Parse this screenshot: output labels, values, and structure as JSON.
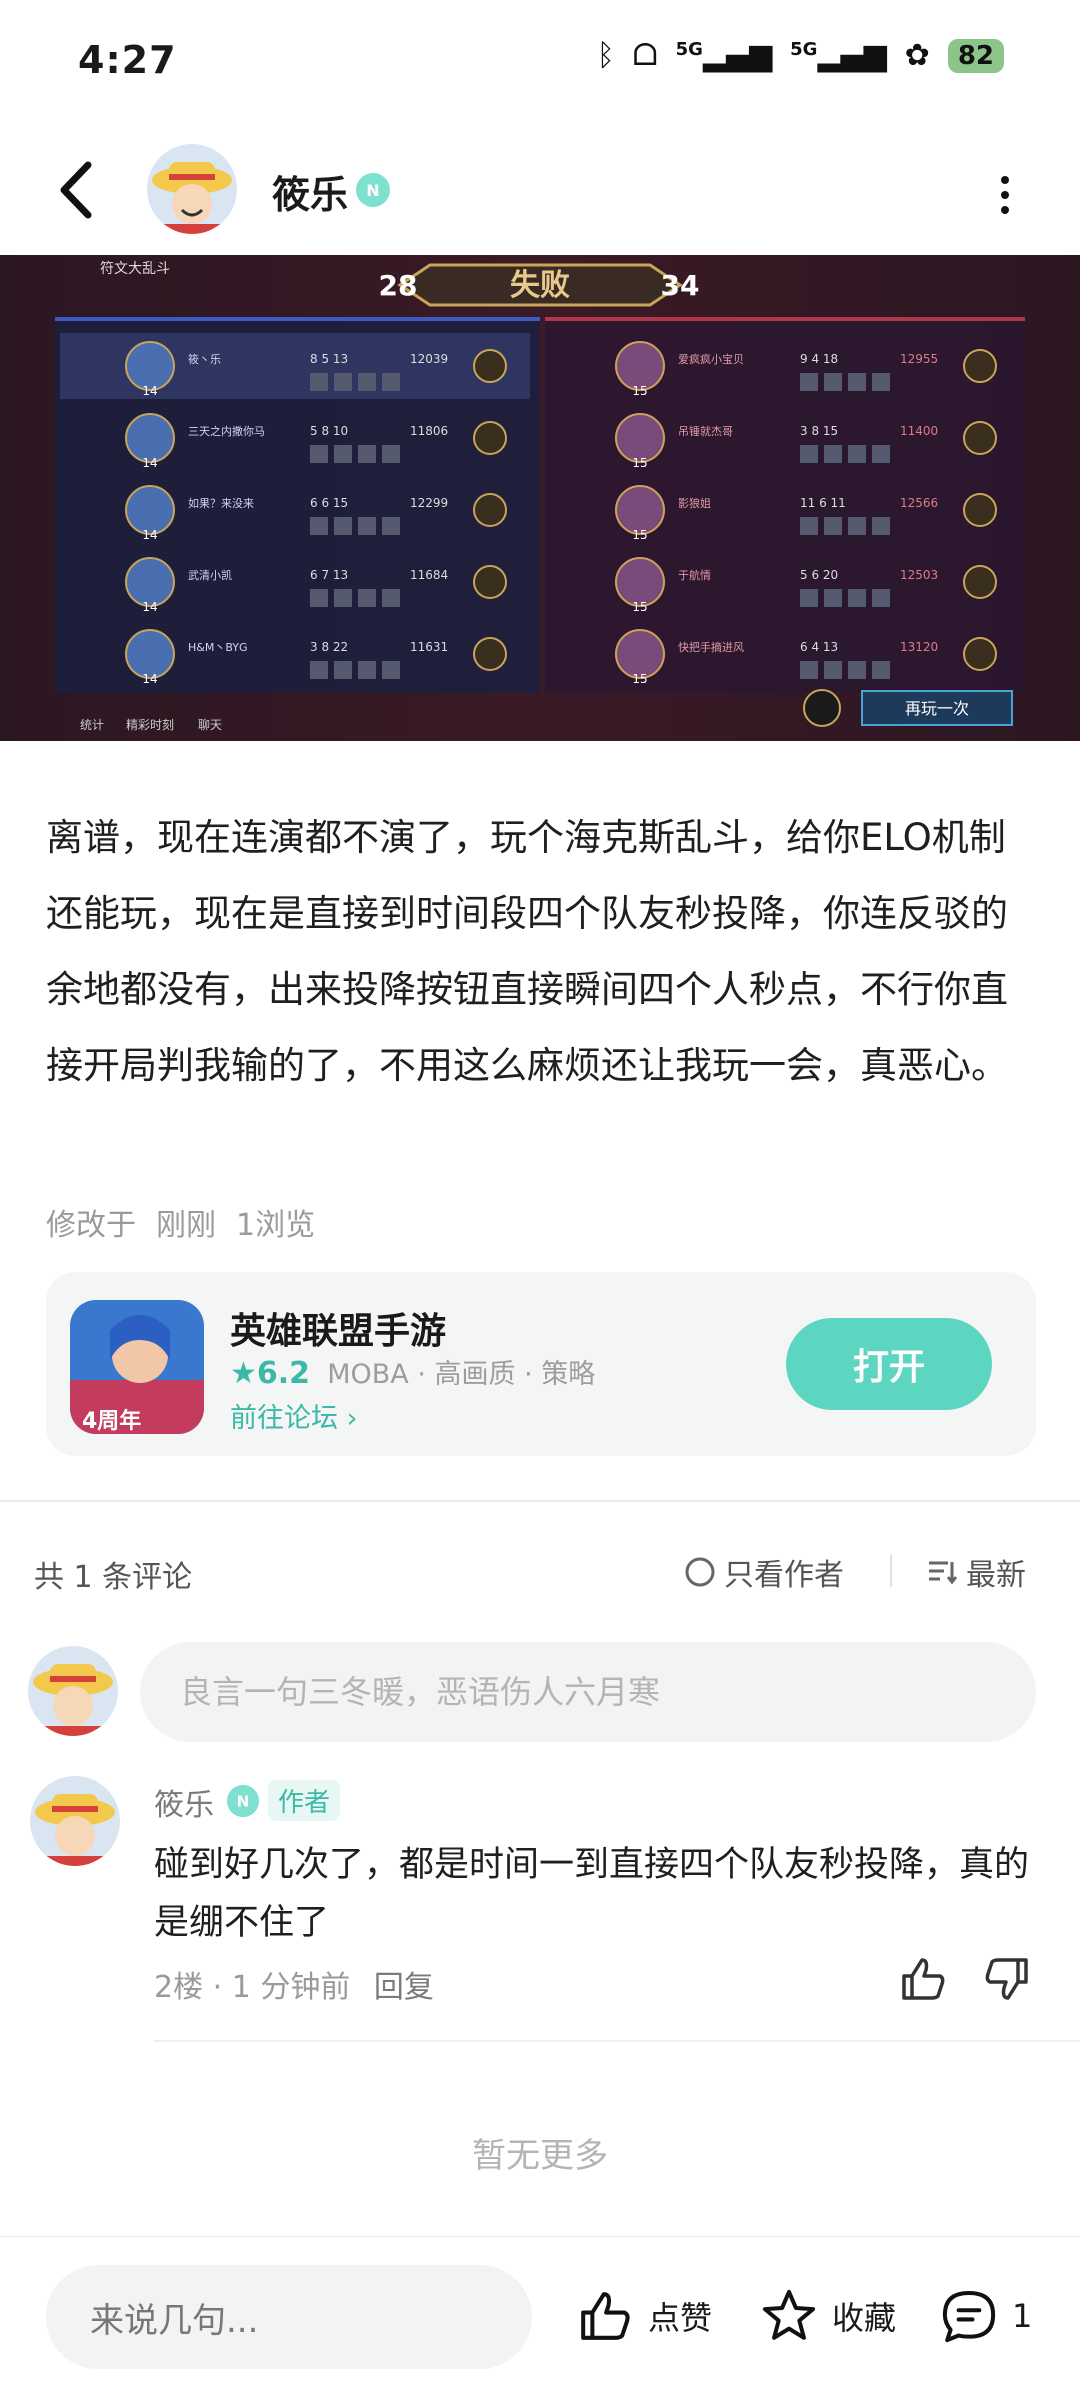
{
  "status_bar": {
    "time": "4:27",
    "battery": "82",
    "network_labels": [
      "5G",
      "5G"
    ]
  },
  "header": {
    "author_name": "筱乐",
    "icons": [
      "back-icon",
      "more-icon",
      "verified-n-badge-icon"
    ]
  },
  "game_screenshot": {
    "mode": "符文大乱斗",
    "result": "失败",
    "score_left": "28",
    "score_right": "34",
    "play_again": "再玩一次",
    "tabs": [
      "统计",
      "精彩时刻",
      "聊天"
    ],
    "left_players": [
      {
        "name": "筱丶乐",
        "level": "14",
        "k": "8",
        "d": "5",
        "a": "13",
        "gold": "12039"
      },
      {
        "name": "三天之内撒你马",
        "level": "14",
        "k": "5",
        "d": "8",
        "a": "10",
        "gold": "11806"
      },
      {
        "name": "如果？来没来",
        "level": "14",
        "k": "6",
        "d": "6",
        "a": "15",
        "gold": "12299"
      },
      {
        "name": "武清小凯",
        "level": "14",
        "k": "6",
        "d": "7",
        "a": "13",
        "gold": "11684"
      },
      {
        "name": "H&M丶BYG",
        "level": "14",
        "k": "3",
        "d": "8",
        "a": "22",
        "gold": "11631"
      }
    ],
    "right_players": [
      {
        "name": "爱疯疯小宝贝",
        "level": "15",
        "k": "9",
        "d": "4",
        "a": "18",
        "gold": "12955"
      },
      {
        "name": "吊锤就杰哥",
        "level": "15",
        "k": "3",
        "d": "8",
        "a": "15",
        "gold": "11400"
      },
      {
        "name": "影狼姐",
        "level": "15",
        "k": "11",
        "d": "6",
        "a": "11",
        "gold": "12566"
      },
      {
        "name": "于航情",
        "level": "15",
        "k": "5",
        "d": "6",
        "a": "20",
        "gold": "12503"
      },
      {
        "name": "快把手摘进风",
        "level": "15",
        "k": "6",
        "d": "4",
        "a": "13",
        "gold": "13120"
      }
    ]
  },
  "post": {
    "body": "离谱，现在连演都不演了，玩个海克斯乱斗，给你ELO机制还能玩，现在是直接到时间段四个队友秒投降，你连反驳的余地都没有，出来投降按钮直接瞬间四个人秒点，不行你直接开局判我输的了，不用这么麻烦还让我玩一会，真恶心。",
    "modified": "修改于",
    "time": "刚刚",
    "views": "1浏览"
  },
  "app_card": {
    "name": "英雄联盟手游",
    "rating": "6.2",
    "tags": "MOBA · 高画质 · 策略",
    "forum_link": "前往论坛",
    "open_label": "打开",
    "icon_badge": "4周年"
  },
  "comments_header": {
    "count": "共 1 条评论",
    "author_only": "只看作者",
    "sort": "最新"
  },
  "comment_input": {
    "placeholder": "良言一句三冬暖，恶语伤人六月寒"
  },
  "comments": [
    {
      "name": "筱乐",
      "tag": "作者",
      "text": "碰到好几次了，都是时间一到直接四个队友秒投降，真的是绷不住了",
      "floor": "2楼",
      "time": "1 分钟前",
      "reply": "回复"
    }
  ],
  "no_more": "暂无更多",
  "bottom_bar": {
    "input_placeholder": "来说几句...",
    "like_label": "点赞",
    "collect_label": "收藏",
    "comment_count": "1"
  },
  "colors": {
    "accent": "#5cd6c0",
    "accent_text": "#3bb9a8"
  }
}
